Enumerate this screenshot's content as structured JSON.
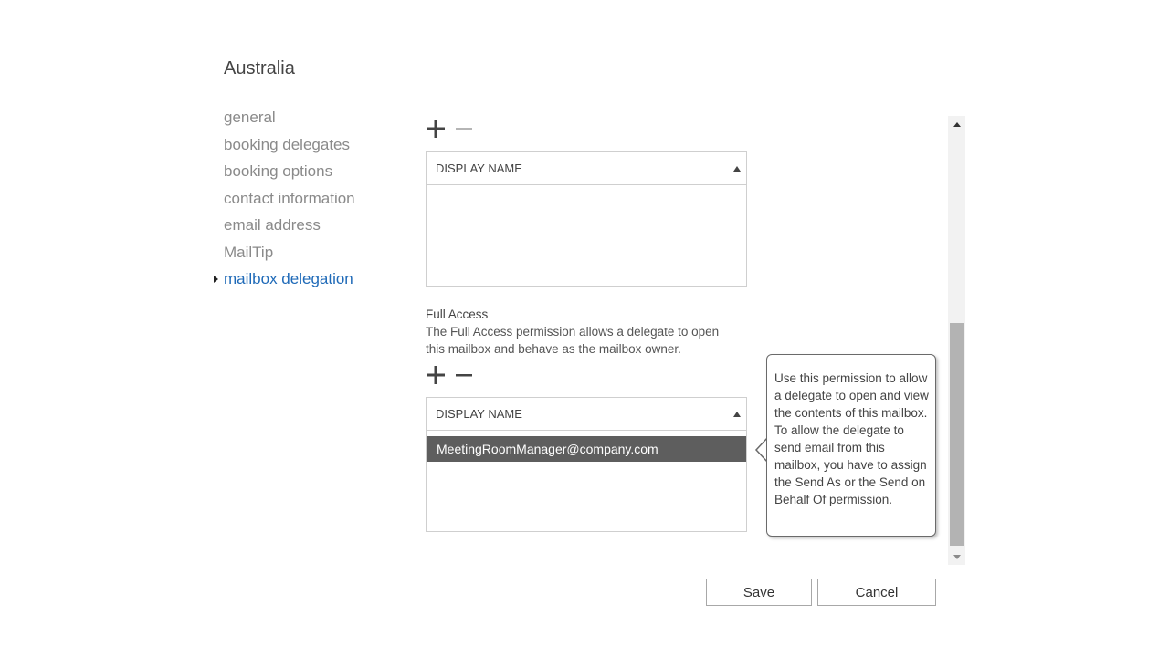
{
  "title": "Australia",
  "nav": {
    "items": [
      {
        "label": "general"
      },
      {
        "label": "booking delegates"
      },
      {
        "label": "booking options"
      },
      {
        "label": "contact information"
      },
      {
        "label": "email address"
      },
      {
        "label": "MailTip"
      },
      {
        "label": "mailbox delegation",
        "active": true
      }
    ]
  },
  "grid1": {
    "toolbar": {
      "add_icon": "plus-icon",
      "remove_icon": "minus-icon"
    },
    "header": "DISPLAY NAME",
    "rows": []
  },
  "full_access": {
    "title": "Full Access",
    "description": "The Full Access permission allows a delegate to open this mailbox and behave as the mailbox owner."
  },
  "grid2": {
    "toolbar": {
      "add_icon": "plus-icon",
      "remove_icon": "minus-icon"
    },
    "header": "DISPLAY NAME",
    "rows": [
      {
        "display_name": "MeetingRoomManager@company.com",
        "selected": true
      }
    ]
  },
  "callout": {
    "text": "Use this permission to allow a delegate to open and view the contents of this mailbox. To allow the delegate to send email from this mailbox, you have to assign the Send As or the Send on Behalf Of permission."
  },
  "buttons": {
    "save": "Save",
    "cancel": "Cancel"
  },
  "colors": {
    "accent": "#1f6ab8",
    "selected_row": "#5e5e5e",
    "nav_text": "#8a8a8a"
  }
}
